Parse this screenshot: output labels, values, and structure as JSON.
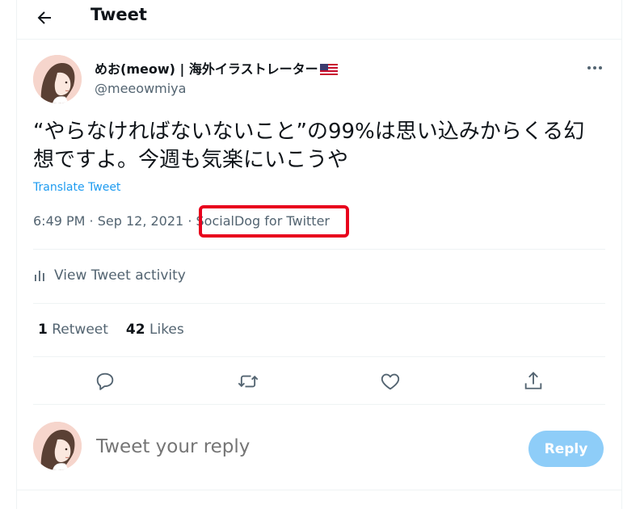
{
  "header": {
    "title": "Tweet",
    "back_icon": "arrow-left-icon"
  },
  "tweet": {
    "author": {
      "display_name": "めお(meow) | 海外イラストレーター",
      "flag_icon": "us-flag-icon",
      "handle": "@meeowmiya",
      "avatar": "illustrated-woman-portrait"
    },
    "more_icon": "ellipsis-icon",
    "text": "“やらなければないないこと”の99%は思い込みからくる幻想ですよ。今週も気楽にいこうや",
    "translate_label": "Translate Tweet",
    "timestamp": "6:49 PM · Sep 12, 2021",
    "separator": "·",
    "source": "SocialDog for Twitter",
    "activity_label": "View Tweet activity",
    "stats": {
      "retweets_count": "1",
      "retweets_label": "Retweet",
      "likes_count": "42",
      "likes_label": "Likes"
    },
    "actions": [
      "reply-icon",
      "retweet-icon",
      "like-icon",
      "share-icon"
    ]
  },
  "reply": {
    "placeholder": "Tweet your reply",
    "button_label": "Reply"
  },
  "colors": {
    "accent": "#1d9bf0",
    "reply_button": "#8ecdf8",
    "highlight": "#e8001c",
    "secondary_text": "#536471"
  }
}
